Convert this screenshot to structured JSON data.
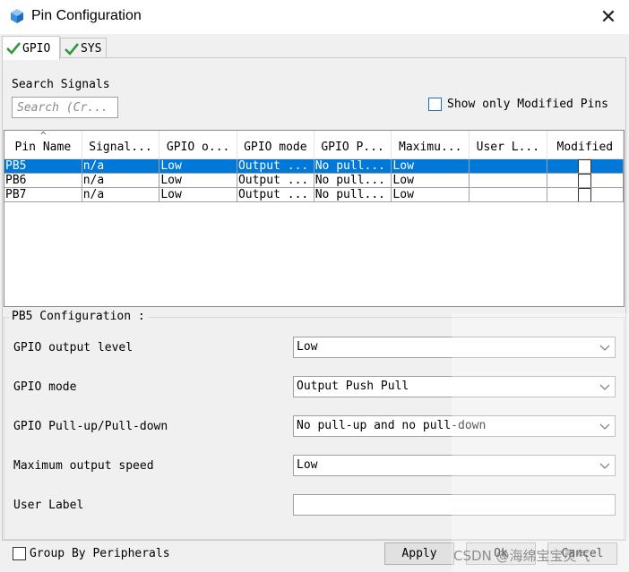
{
  "window": {
    "title": "Pin Configuration",
    "close_glyph": "✕",
    "icon": "cube-app-icon"
  },
  "tabs": [
    {
      "label": "GPIO",
      "active": true,
      "icon": "green-check-icon"
    },
    {
      "label": "SYS",
      "active": false,
      "icon": "green-check-icon"
    }
  ],
  "search": {
    "label": "Search Signals",
    "placeholder": "Search (Cr..."
  },
  "show_modified": {
    "label": "Show only Modified Pins",
    "checked": false
  },
  "table": {
    "columns": [
      "Pin Name",
      "Signal...",
      "GPIO o...",
      "GPIO mode",
      "GPIO P...",
      "Maximu...",
      "User L...",
      "Modified"
    ],
    "rows": [
      {
        "pin": "PB5",
        "signal": "n/a",
        "output": "Low",
        "mode": "Output ...",
        "pull": "No pull...",
        "speed": "Low",
        "label": "",
        "modified": false,
        "selected": true
      },
      {
        "pin": "PB6",
        "signal": "n/a",
        "output": "Low",
        "mode": "Output ...",
        "pull": "No pull...",
        "speed": "Low",
        "label": "",
        "modified": false,
        "selected": false
      },
      {
        "pin": "PB7",
        "signal": "n/a",
        "output": "Low",
        "mode": "Output ...",
        "pull": "No pull...",
        "speed": "Low",
        "label": "",
        "modified": false,
        "selected": false
      }
    ]
  },
  "config": {
    "title": "PB5 Configuration :",
    "fields": [
      {
        "label": "GPIO output level",
        "value": "Low"
      },
      {
        "label": "GPIO mode",
        "value": "Output Push Pull"
      },
      {
        "label": "GPIO Pull-up/Pull-down",
        "value": "No pull-up and no pull-down"
      },
      {
        "label": "Maximum output speed",
        "value": "Low"
      }
    ],
    "user_label": {
      "label": "User Label",
      "value": ""
    }
  },
  "footer": {
    "group_by_label": "Group By Peripherals",
    "apply_label": "Apply",
    "ok_label": "Ok",
    "cancel_label": "Cancel"
  },
  "watermark": "CSDN @海绵宝宝灵气",
  "colors": {
    "selection": "#0078d7",
    "checkbox_accent": "#1b6ec2",
    "check_green": "#2e9b3a"
  }
}
